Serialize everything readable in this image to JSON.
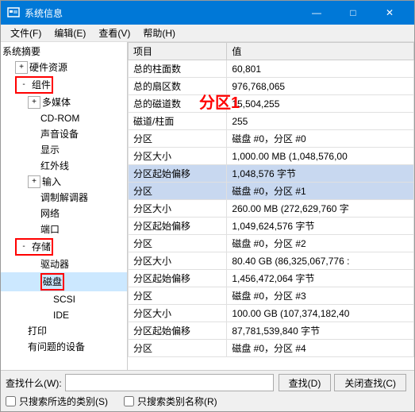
{
  "window": {
    "title": "系统信息",
    "controls": {
      "minimize": "—",
      "maximize": "□",
      "close": "✕"
    }
  },
  "menu": {
    "items": [
      "文件(F)",
      "编辑(E)",
      "查看(V)",
      "帮助(H)"
    ]
  },
  "left_panel": {
    "items": [
      {
        "id": "system",
        "label": "系统摘要",
        "indent": 0,
        "expander": null
      },
      {
        "id": "hardware",
        "label": "硬件资源",
        "indent": 1,
        "expander": "+"
      },
      {
        "id": "components",
        "label": "组件",
        "indent": 1,
        "expander": "-",
        "highlight": true
      },
      {
        "id": "multimedia",
        "label": "多媒体",
        "indent": 2,
        "expander": "+"
      },
      {
        "id": "cdrom",
        "label": "CD-ROM",
        "indent": 2,
        "expander": null
      },
      {
        "id": "audio",
        "label": "声音设备",
        "indent": 2,
        "expander": null
      },
      {
        "id": "display",
        "label": "显示",
        "indent": 2,
        "expander": null
      },
      {
        "id": "infrared",
        "label": "红外线",
        "indent": 2,
        "expander": null
      },
      {
        "id": "input",
        "label": "输入",
        "indent": 2,
        "expander": "+"
      },
      {
        "id": "modem",
        "label": "调制解调器",
        "indent": 2,
        "expander": null
      },
      {
        "id": "network",
        "label": "网络",
        "indent": 2,
        "expander": null
      },
      {
        "id": "ports",
        "label": "端口",
        "indent": 2,
        "expander": null
      },
      {
        "id": "storage",
        "label": "存储",
        "indent": 1,
        "expander": "-",
        "highlight": true
      },
      {
        "id": "drives",
        "label": "驱动器",
        "indent": 2,
        "expander": null
      },
      {
        "id": "disks",
        "label": "磁盘",
        "indent": 3,
        "expander": null,
        "selected": true,
        "highlight_box": true
      },
      {
        "id": "scsi",
        "label": "SCSI",
        "indent": 3,
        "expander": null
      },
      {
        "id": "ide",
        "label": "IDE",
        "indent": 3,
        "expander": null
      },
      {
        "id": "print",
        "label": "打印",
        "indent": 1,
        "expander": null
      },
      {
        "id": "problems",
        "label": "有问题的设备",
        "indent": 1,
        "expander": null
      }
    ]
  },
  "right_panel": {
    "columns": [
      "项目",
      "值"
    ],
    "rows": [
      {
        "label": "总的柱面数",
        "value": "60,801"
      },
      {
        "label": "总的扇区数",
        "value": "976,768,065"
      },
      {
        "label": "总的磁道数",
        "value": "15,504,255"
      },
      {
        "label": "磁道/柱面",
        "value": "255"
      },
      {
        "label": "分区",
        "value": "磁盘 #0，分区 #0"
      },
      {
        "label": "分区大小",
        "value": "1,000.00 MB (1,048,576,00"
      },
      {
        "label": "分区起始偏移",
        "value": "1,048,576 字节",
        "highlight": true
      },
      {
        "label": "分区",
        "value": "磁盘 #0，分区 #1",
        "highlight": true
      },
      {
        "label": "分区大小",
        "value": "260.00 MB (272,629,760 字"
      },
      {
        "label": "分区起始偏移",
        "value": "1,049,624,576 字节"
      },
      {
        "label": "分区",
        "value": "磁盘 #0，分区 #2"
      },
      {
        "label": "分区大小",
        "value": "80.40 GB (86,325,067,776 :"
      },
      {
        "label": "分区起始偏移",
        "value": "1,456,472,064 字节"
      },
      {
        "label": "分区",
        "value": "磁盘 #0，分区 #3"
      },
      {
        "label": "分区大小",
        "value": "100.00 GB (107,374,182,40"
      },
      {
        "label": "分区起始偏移",
        "value": "87,781,539,840 字节"
      },
      {
        "label": "分区",
        "value": "磁盘 #0，分区 #4"
      }
    ],
    "annotation": "分区1"
  },
  "bottom": {
    "search_label": "查找什么(W):",
    "search_placeholder": "",
    "find_btn": "查找(D)",
    "close_find_btn": "关闭查找(C)",
    "checkbox1": "只搜索所选的类别(S)",
    "checkbox2": "只搜索类别名称(R)"
  }
}
